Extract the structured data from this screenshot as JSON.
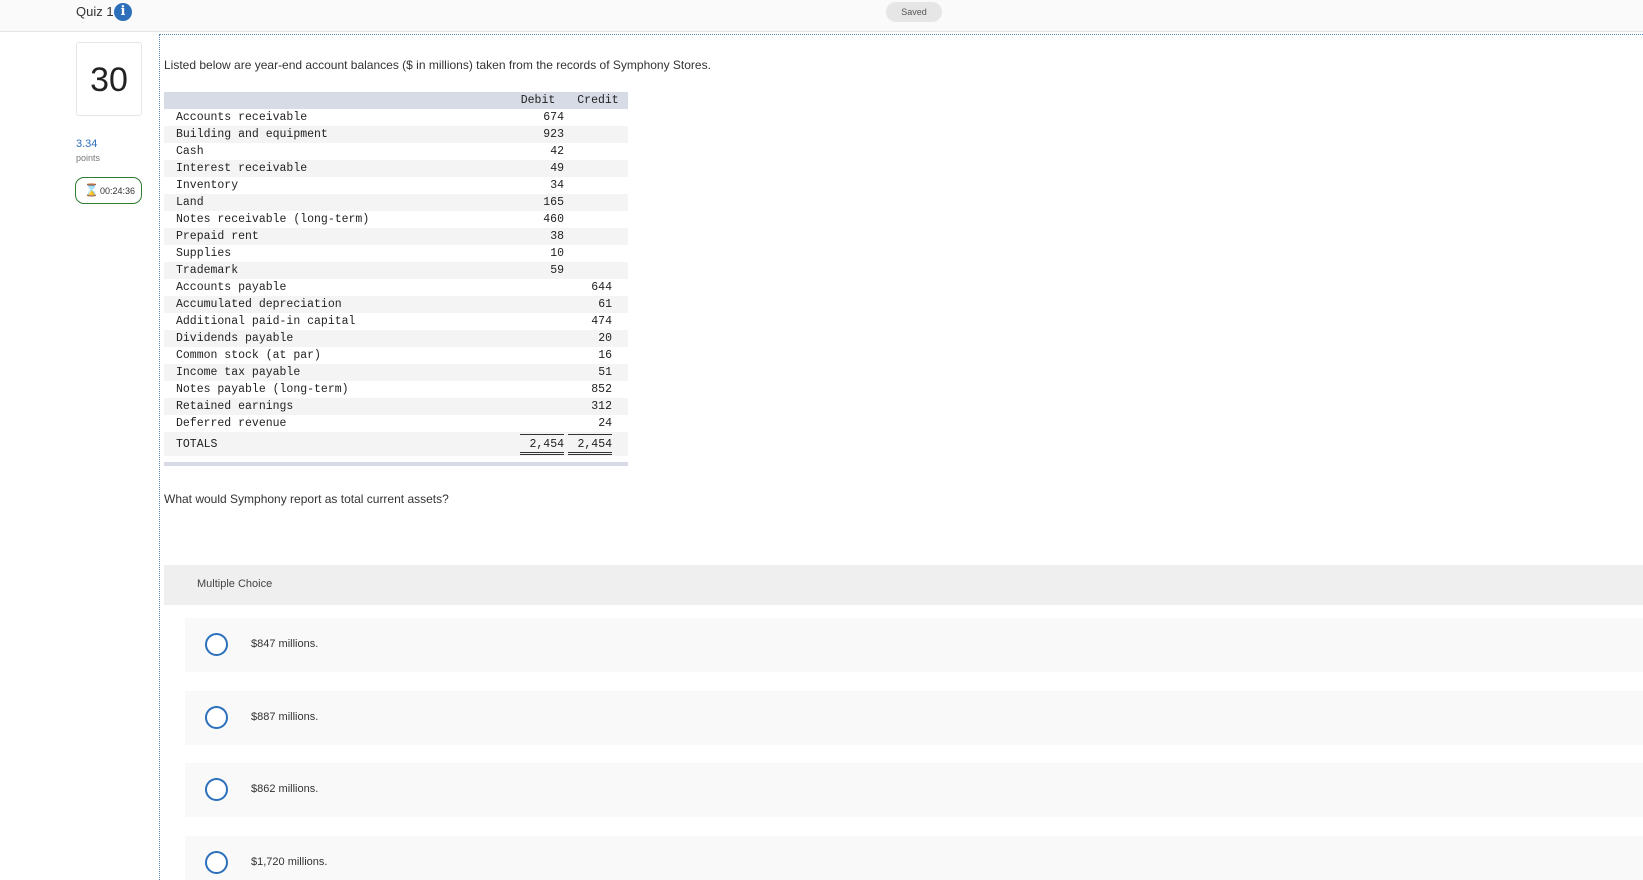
{
  "header": {
    "quiz_title": "Quiz 1",
    "info_icon": "info-icon",
    "saved_label": "Saved"
  },
  "question_meta": {
    "number": "30",
    "points_value": "3.34",
    "points_label": "points",
    "timer_icon": "hourglass-icon",
    "timer": "00:24:36"
  },
  "prompt": "Listed below are year-end account balances ($ in millions) taken from the records of Symphony Stores.",
  "table": {
    "headers": {
      "account": "",
      "debit": "Debit",
      "credit": "Credit"
    },
    "rows": [
      {
        "account": "Accounts receivable",
        "debit": "674",
        "credit": ""
      },
      {
        "account": "Building and equipment",
        "debit": "923",
        "credit": ""
      },
      {
        "account": "Cash",
        "debit": "42",
        "credit": ""
      },
      {
        "account": "Interest receivable",
        "debit": "49",
        "credit": ""
      },
      {
        "account": "Inventory",
        "debit": "34",
        "credit": ""
      },
      {
        "account": "Land",
        "debit": "165",
        "credit": ""
      },
      {
        "account": "Notes receivable (long-term)",
        "debit": "460",
        "credit": ""
      },
      {
        "account": "Prepaid rent",
        "debit": "38",
        "credit": ""
      },
      {
        "account": "Supplies",
        "debit": "10",
        "credit": ""
      },
      {
        "account": "Trademark",
        "debit": "59",
        "credit": ""
      },
      {
        "account": "Accounts payable",
        "debit": "",
        "credit": "644"
      },
      {
        "account": "Accumulated depreciation",
        "debit": "",
        "credit": "61"
      },
      {
        "account": "Additional paid-in capital",
        "debit": "",
        "credit": "474"
      },
      {
        "account": "Dividends payable",
        "debit": "",
        "credit": "20"
      },
      {
        "account": "Common stock (at par)",
        "debit": "",
        "credit": "16"
      },
      {
        "account": "Income tax payable",
        "debit": "",
        "credit": "51"
      },
      {
        "account": "Notes payable (long-term)",
        "debit": "",
        "credit": "852"
      },
      {
        "account": "Retained earnings",
        "debit": "",
        "credit": "312"
      },
      {
        "account": "Deferred revenue",
        "debit": "",
        "credit": "24"
      }
    ],
    "totals": {
      "label": "TOTALS",
      "debit": "2,454",
      "credit": "2,454"
    }
  },
  "question": "What would Symphony report as total current assets?",
  "multiple_choice": {
    "header": "Multiple Choice",
    "options": [
      {
        "label": "$847 millions."
      },
      {
        "label": "$887 millions."
      },
      {
        "label": "$862 millions."
      },
      {
        "label": "$1,720 millions."
      }
    ]
  },
  "colors": {
    "accent_blue": "#2c6fbb",
    "timer_green": "#2e7d32",
    "table_header_bg": "#d6dbe5"
  }
}
